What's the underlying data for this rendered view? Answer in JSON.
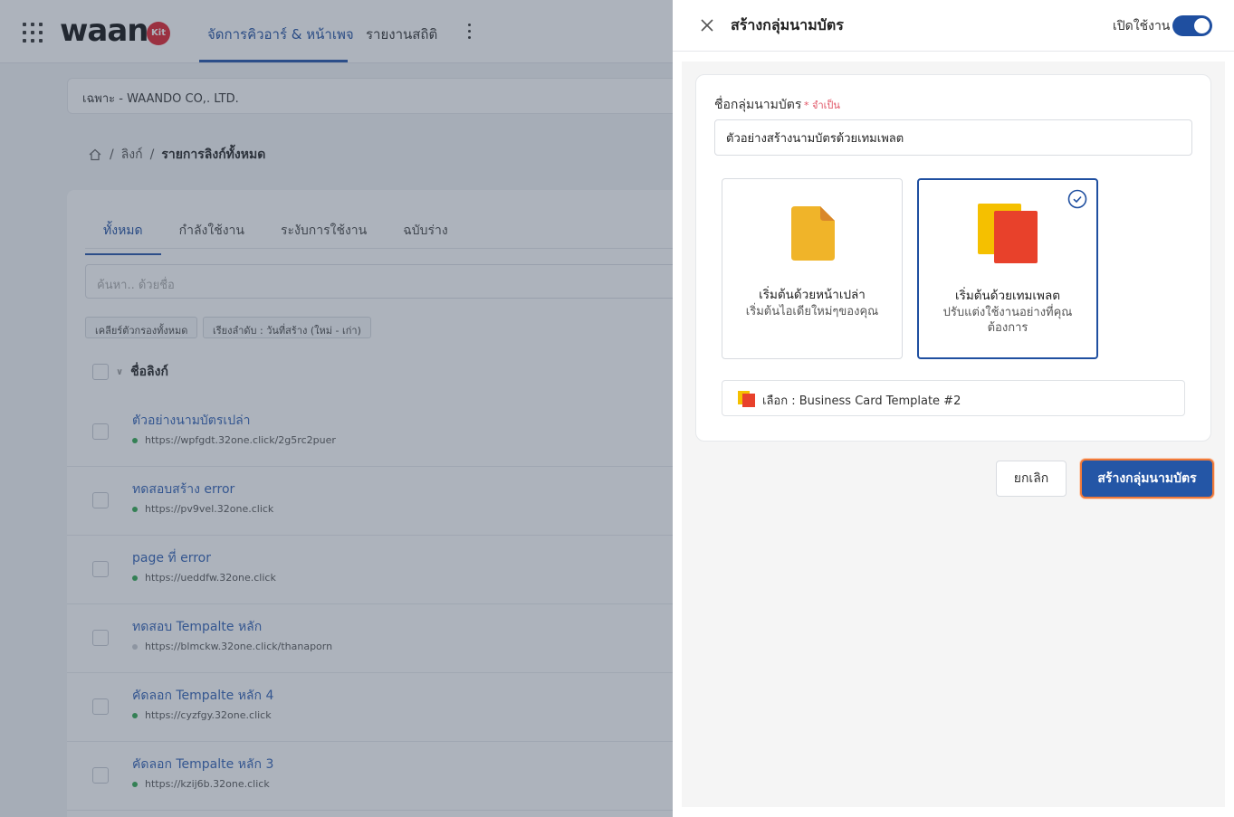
{
  "app": {
    "brand": "waan",
    "brand_badge": "Kit",
    "nav": [
      "จัดการคิวอาร์ & หน้าเพจ",
      "รายงานสถิติ"
    ],
    "org": "เฉพาะ - WAANDO CO,. LTD."
  },
  "breadcrumb": {
    "part1": "ลิงก์",
    "current": "รายการลิงก์ทั้งหมด",
    "sep": "/"
  },
  "list": {
    "tabs": [
      "ทั้งหมด",
      "กำลังใช้งาน",
      "ระงับการใช้งาน",
      "ฉบับร่าง"
    ],
    "search_placeholder": "ค้นหา.. ด้วยชื่อ",
    "filters": [
      "เคลียร์ตัวกรองทั้งหมด",
      "เรียงลำดับ : วันที่สร้าง (ใหม่ - เก่า)"
    ],
    "column_header": "ชื่อลิงก์",
    "rows": [
      {
        "title": "ตัวอย่างนามบัตรเปล่า",
        "url": "https://wpfgdt.32one.click/2g5rc2puer",
        "status": "active"
      },
      {
        "title": "ทดสอบสร้าง error",
        "url": "https://pv9vel.32one.click",
        "status": "active"
      },
      {
        "title": "page ที่ error",
        "url": "https://ueddfw.32one.click",
        "status": "active"
      },
      {
        "title": "ทดสอบ Tempalte หลัก",
        "url": "https://blmckw.32one.click/thanaporn",
        "status": "inactive"
      },
      {
        "title": "คัดลอก Tempalte หลัก 4",
        "url": "https://cyzfgy.32one.click",
        "status": "active"
      },
      {
        "title": "คัดลอก Tempalte หลัก 3",
        "url": "https://kzij6b.32one.click",
        "status": "active"
      }
    ]
  },
  "drawer": {
    "title": "สร้างกลุ่มนามบัตร",
    "enable_label": "เปิดใช้งาน",
    "enabled": true,
    "field_label": "ชื่อกลุ่มนามบัตร",
    "required_text": "* จำเป็น",
    "name_value": "ตัวอย่างสร้างนามบัตรด้วยเทมเพลต",
    "options": [
      {
        "title": "เริ่มต้นด้วยหน้าเปล่า",
        "subtitle": "เริ่มต้นไอเดียใหม่ๆของคุณ",
        "selected": false
      },
      {
        "title": "เริ่มต้นด้วยเทมเพลต",
        "subtitle": "ปรับแต่งใช้งานอย่างที่คุณต้องการ",
        "selected": true
      }
    ],
    "template_selected": "เลือก : Business Card Template #2",
    "cancel_label": "ยกเลิก",
    "create_label": "สร้างกลุ่มนามบัตร"
  },
  "colors": {
    "primary": "#1f4fa0",
    "link": "#2f5fb3",
    "required": "#e05263",
    "focus_ring": "#f07a3a",
    "blank_icon": "#f0b429",
    "template_icon_back": "#f5c000",
    "template_icon_front": "#e8412b"
  }
}
